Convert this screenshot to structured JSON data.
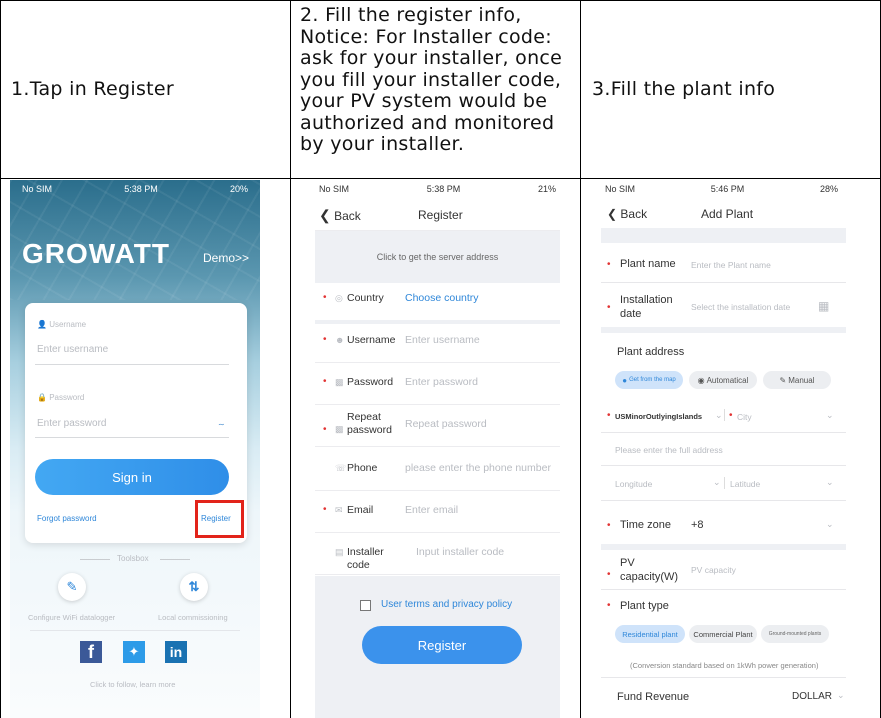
{
  "header": {
    "step1": "1.Tap in Register",
    "step2": [
      "2. Fill the register info,",
      "Notice: For Installer code:",
      "ask for your installer, once",
      "you fill your installer code,",
      "your PV system would be",
      "authorized and monitored",
      "by your installer."
    ],
    "step3": "3.Fill the plant info"
  },
  "screen1": {
    "status": {
      "carrier": "No SIM",
      "time": "5:38 PM",
      "battery": "20%"
    },
    "brand": "GROWATT",
    "demo": "Demo>>",
    "username_label": "Username",
    "username_placeholder": "Enter username",
    "password_label": "Password",
    "password_placeholder": "Enter password",
    "sign_in": "Sign in",
    "forgot": "Forgot password",
    "register": "Register",
    "toolbox": "Toolsbox",
    "tool1": "Configure WiFi datalogger",
    "tool2": "Local commissioning",
    "follow": "Click to follow, learn more",
    "colors": {
      "accent": "#2f9bf0",
      "highlight": "#e2231a"
    }
  },
  "screen2": {
    "status": {
      "carrier": "No SIM",
      "time": "5:38 PM",
      "battery": "21%"
    },
    "back": "Back",
    "title": "Register",
    "server": "Click to get the server address",
    "fields": [
      {
        "label": "Country",
        "value": "Choose country",
        "required": true
      },
      {
        "label": "Username",
        "value": "Enter username",
        "required": true
      },
      {
        "label": "Password",
        "value": "Enter password",
        "required": true
      },
      {
        "label": "Repeat password",
        "value": "Repeat password",
        "required": true
      },
      {
        "label": "Phone",
        "value": "please enter the  phone number",
        "required": false
      },
      {
        "label": "Email",
        "value": "Enter email",
        "required": true
      },
      {
        "label": "Installer code",
        "value": "Input installer code",
        "required": false
      }
    ],
    "terms": "User terms and privacy policy",
    "register_button": "Register"
  },
  "screen3": {
    "status": {
      "carrier": "No SIM",
      "time": "5:46 PM",
      "battery": "28%"
    },
    "back": "Back",
    "title": "Add Plant",
    "plant_name_label": "Plant name",
    "plant_name_placeholder": "Enter the Plant name",
    "install_label_1": "Installation",
    "install_label_2": "date",
    "install_placeholder": "Select the installation date",
    "address_label": "Plant address",
    "addr_btn_map": "Get from the map",
    "addr_btn_auto": "Automatical",
    "addr_btn_manual": "Manual",
    "country_value": "USMinorOutlyingIslands",
    "city_placeholder": "City",
    "full_address": "Please enter the full address",
    "longitude": "Longitude",
    "latitude": "Latitude",
    "timezone_label": "Time zone",
    "timezone_value": "+8",
    "pv_label_1": "PV",
    "pv_label_2": "capacity(W)",
    "pv_placeholder": "PV capacity",
    "plant_type_label": "Plant type",
    "type_residential": "Residential plant",
    "type_commercial": "Commercial Plant",
    "type_ground": "Ground-mounted plants",
    "conversion_note": "(Conversion standard based on 1kWh power generation)",
    "fund_label": "Fund Revenue",
    "fund_value": "DOLLAR"
  }
}
